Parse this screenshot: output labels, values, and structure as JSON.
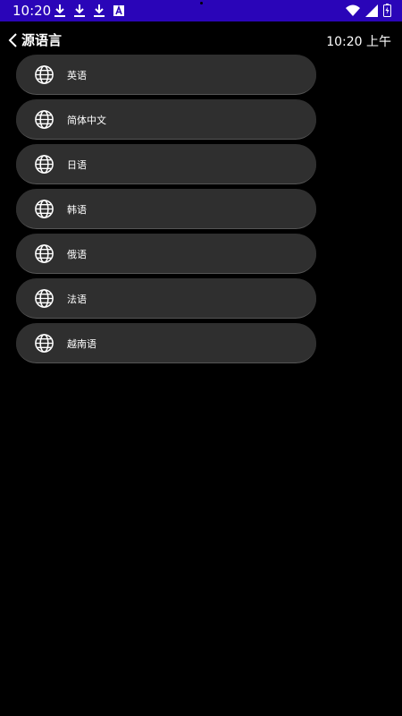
{
  "status_bar": {
    "time": "10:20",
    "left_icons": [
      "download-icon",
      "download-icon",
      "download-icon",
      "a-icon"
    ],
    "right_icons": [
      "wifi-icon",
      "signal-icon",
      "battery-icon"
    ],
    "background": "#2a05b8"
  },
  "header": {
    "title": "源语言",
    "time": "10:20 上午"
  },
  "languages": [
    {
      "label": "英语",
      "icon": "globe-icon"
    },
    {
      "label": "简体中文",
      "icon": "globe-icon"
    },
    {
      "label": "日语",
      "icon": "globe-icon"
    },
    {
      "label": "韩语",
      "icon": "globe-icon"
    },
    {
      "label": "俄语",
      "icon": "globe-icon"
    },
    {
      "label": "法语",
      "icon": "globe-icon"
    },
    {
      "label": "越南语",
      "icon": "globe-icon"
    }
  ],
  "colors": {
    "background": "#000000",
    "item_background": "#2f2f2f",
    "text": "#ffffff"
  }
}
